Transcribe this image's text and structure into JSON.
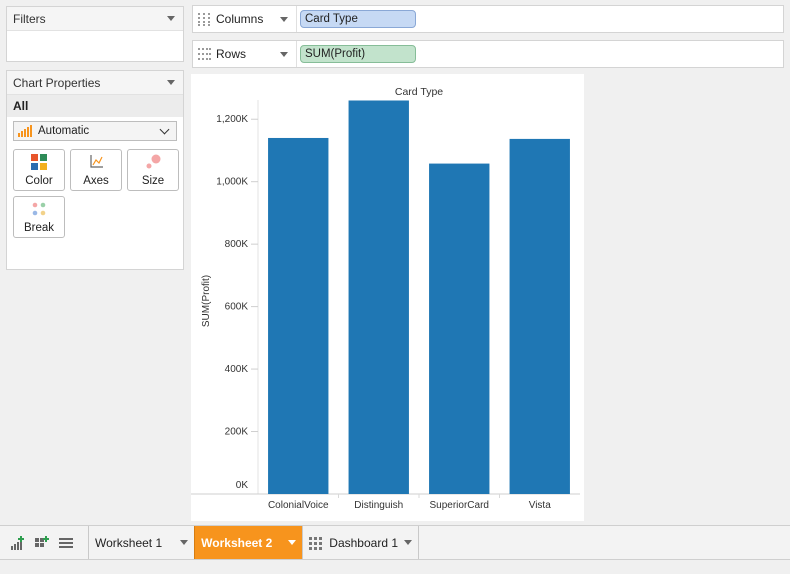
{
  "filters": {
    "title": "Filters"
  },
  "chart_properties": {
    "title": "Chart Properties",
    "scope": "All",
    "mark_type": "Automatic",
    "cards": [
      "Color",
      "Axes",
      "Size",
      "Break"
    ]
  },
  "shelves": {
    "columns": {
      "label": "Columns",
      "pill": "Card Type"
    },
    "rows": {
      "label": "Rows",
      "pill": "SUM(Profit)"
    }
  },
  "chart_data": {
    "type": "bar",
    "title": "Card Type",
    "xlabel": "",
    "ylabel": "SUM(Profit)",
    "categories": [
      "ColonialVoice",
      "Distinguish",
      "SuperiorCard",
      "Vista"
    ],
    "values": [
      1140000,
      1260000,
      1058000,
      1137000
    ],
    "ylim": [
      0,
      1300000
    ],
    "yticks": [
      0,
      200000,
      400000,
      600000,
      800000,
      1000000,
      1200000
    ],
    "ytick_labels": [
      "0K",
      "200K",
      "400K",
      "600K",
      "800K",
      "1,000K",
      "1,200K"
    ],
    "bar_color": "#1f77b4",
    "grid": false
  },
  "tabs": {
    "items": [
      {
        "label": "Worksheet 1",
        "active": false,
        "icon": ""
      },
      {
        "label": "Worksheet 2",
        "active": true,
        "icon": ""
      },
      {
        "label": "Dashboard 1",
        "active": false,
        "icon": "dashboard-grid-icon"
      }
    ],
    "active_color": "#f7941d"
  }
}
